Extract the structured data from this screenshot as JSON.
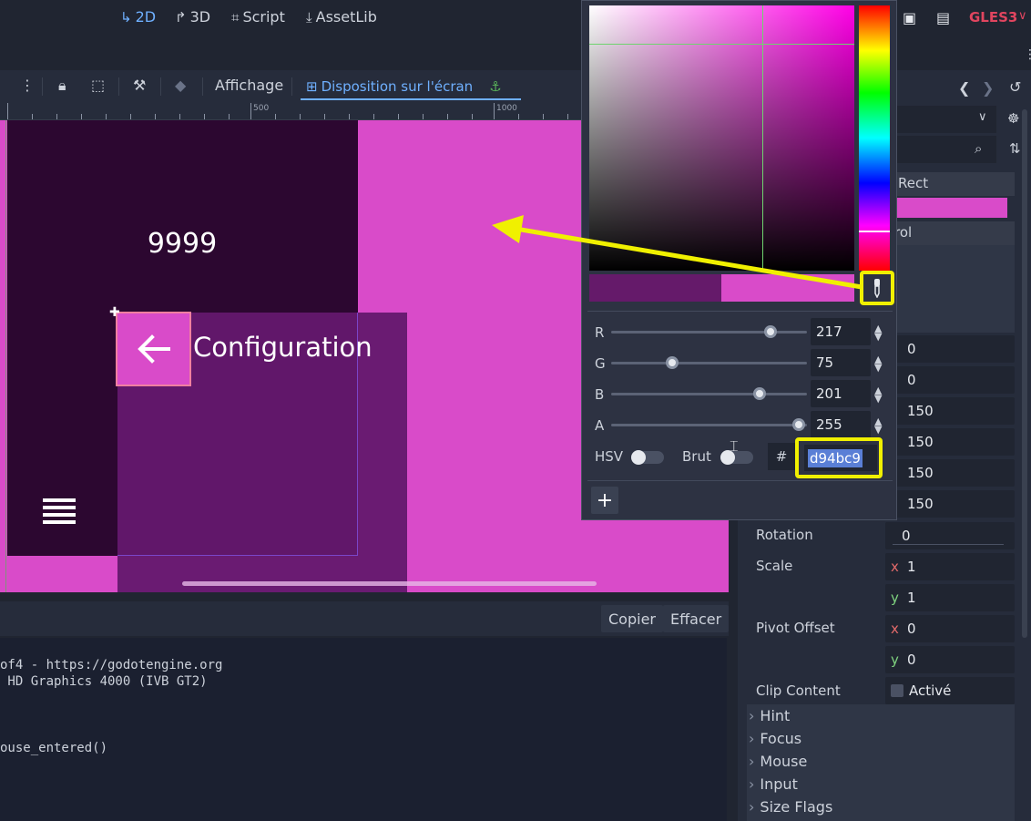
{
  "workspace": {
    "tabs": [
      {
        "label": "2D",
        "icon": "2d-icon"
      },
      {
        "label": "3D",
        "icon": "3d-icon"
      },
      {
        "label": "Script",
        "icon": "script-icon"
      },
      {
        "label": "AssetLib",
        "icon": "assetlib-icon"
      }
    ],
    "renderer": "GLES3"
  },
  "toolbar": {
    "view_label": "Affichage",
    "layout_label": "Disposition sur l'écran"
  },
  "ruler": {
    "labels": [
      "500",
      "1000"
    ]
  },
  "viewport": {
    "score_text": "9999",
    "config_label": "Configuration",
    "colors": {
      "background": "#d94bc9",
      "dark_panel": "#2c0730"
    }
  },
  "output": {
    "copy_label": "Copier",
    "clear_label": "Effacer",
    "lines": [
      "of4 - https://godotengine.org",
      " HD Graphics 4000 (IVB GT2)",
      "",
      "",
      "ouse_entered()"
    ]
  },
  "inspector": {
    "header_fragments": [
      "Rect",
      "rol"
    ],
    "numeric_values": [
      "0",
      "0",
      "150",
      "150",
      "150",
      "150"
    ],
    "rotation": {
      "label": "Rotation",
      "value": "0"
    },
    "scale": {
      "label": "Scale",
      "x": "1",
      "y": "1"
    },
    "pivot": {
      "label": "Pivot Offset",
      "x": "0",
      "y": "0"
    },
    "clip": {
      "label": "Clip Content",
      "value": "Activé"
    },
    "sections": [
      "Hint",
      "Focus",
      "Mouse",
      "Input",
      "Size Flags"
    ],
    "axis_x": "x",
    "axis_y": "y"
  },
  "color_picker": {
    "channels": [
      {
        "label": "R",
        "value": "217"
      },
      {
        "label": "G",
        "value": "75"
      },
      {
        "label": "B",
        "value": "201"
      },
      {
        "label": "A",
        "value": "255"
      }
    ],
    "hsv_label": "HSV",
    "raw_label": "Brut",
    "hash_label": "#",
    "hex_value": "d94bc9",
    "add_label": "+",
    "current_color": "#d94bc9",
    "previous_color": "#651a6a"
  }
}
